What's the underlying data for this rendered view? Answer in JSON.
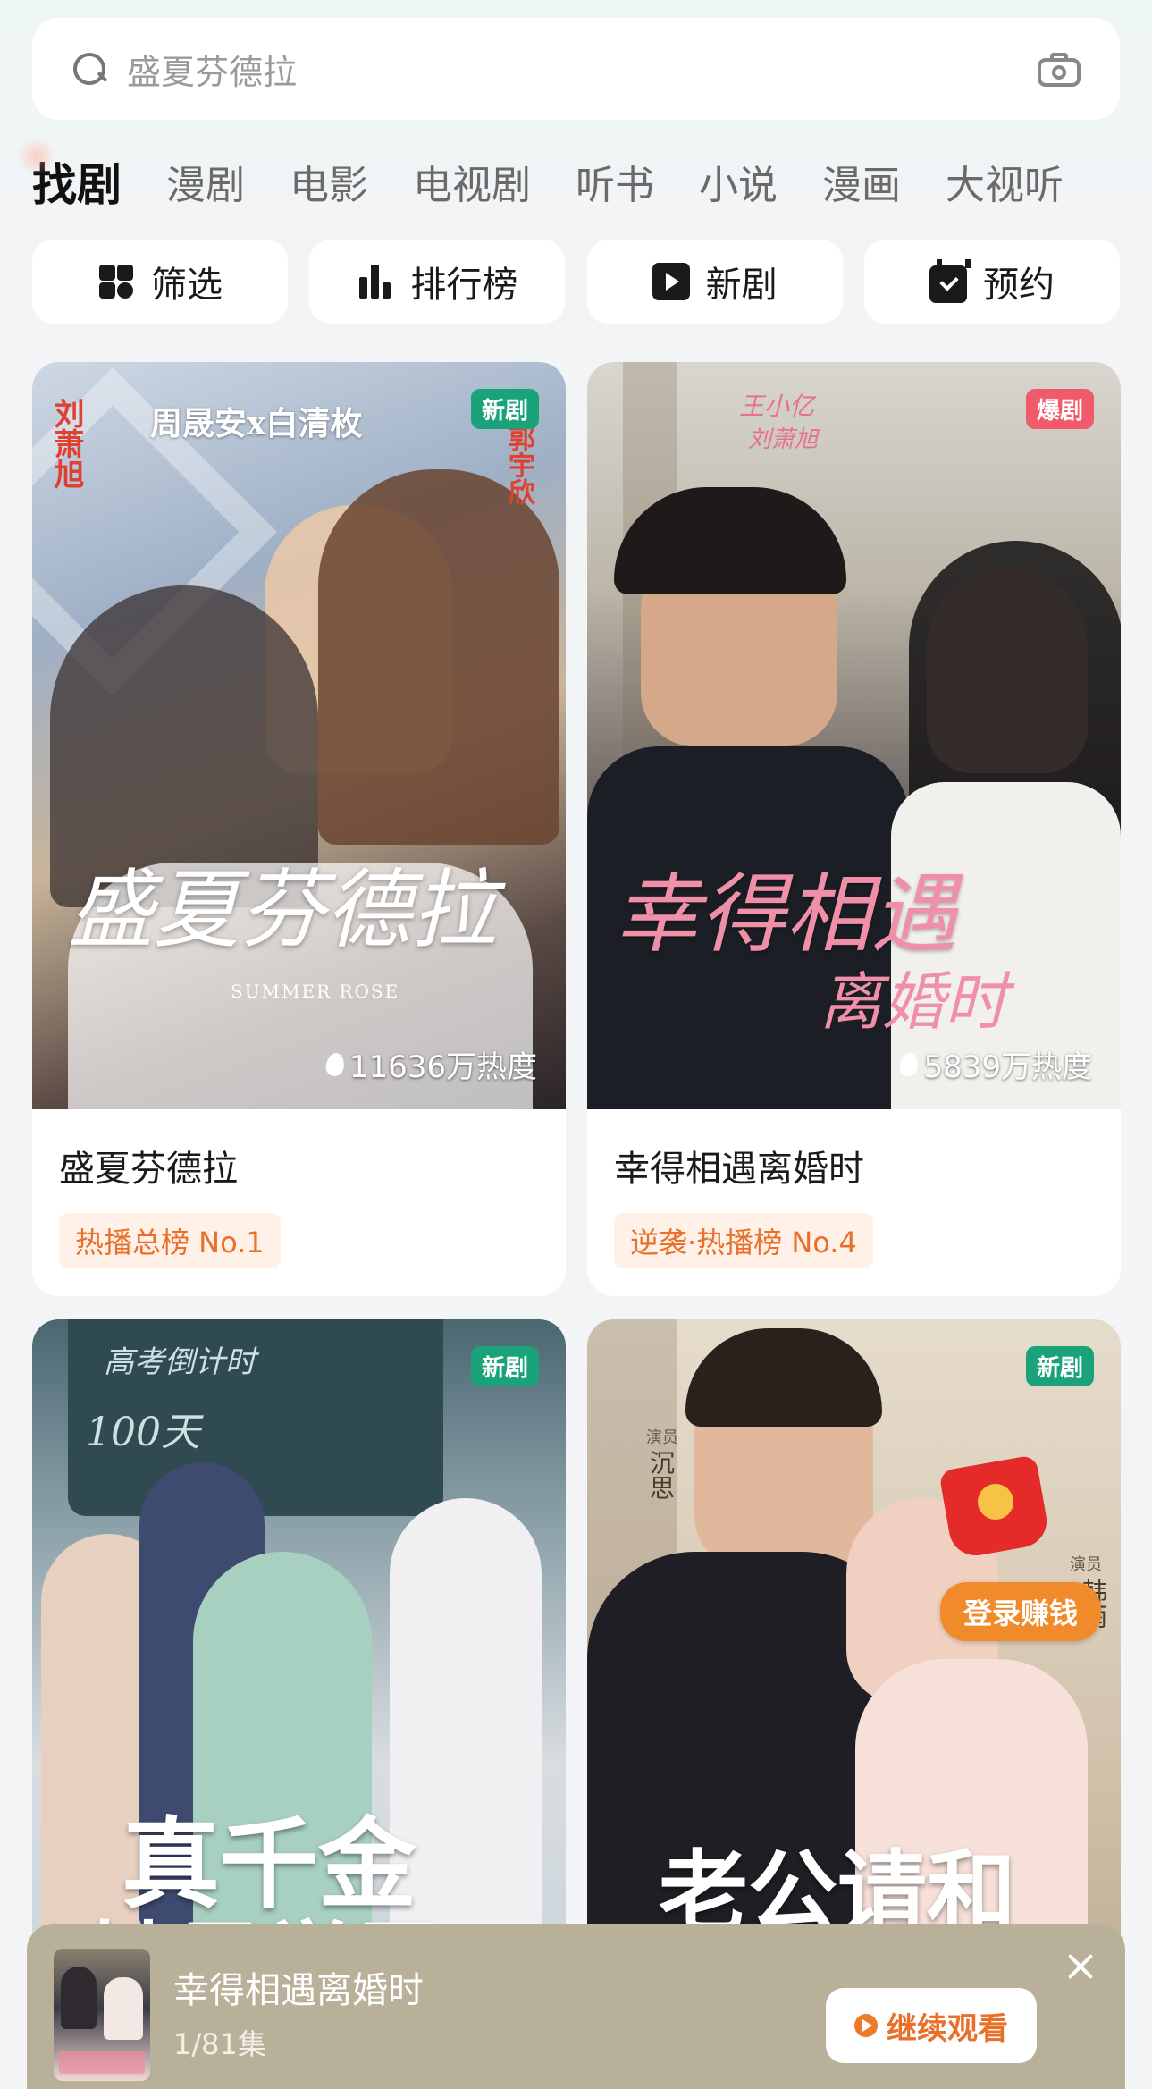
{
  "search": {
    "placeholder": "盛夏芬德拉"
  },
  "tabs": [
    {
      "label": "找剧",
      "active": true
    },
    {
      "label": "漫剧"
    },
    {
      "label": "电影"
    },
    {
      "label": "电视剧"
    },
    {
      "label": "听书"
    },
    {
      "label": "小说"
    },
    {
      "label": "漫画"
    },
    {
      "label": "大视听"
    }
  ],
  "quick": [
    {
      "label": "筛选",
      "icon": "grid-icon"
    },
    {
      "label": "排行榜",
      "icon": "chart-icon"
    },
    {
      "label": "新剧",
      "icon": "play-icon"
    },
    {
      "label": "预约",
      "icon": "calendar-icon"
    }
  ],
  "cards": [
    {
      "badge": "新剧",
      "heat": "11636万热度",
      "title": "盛夏芬德拉",
      "rank": "热播总榜 No.1",
      "poster_text": {
        "main": "盛夏芬德拉",
        "sub": "SUMMER ROSE",
        "cast_center": "周晟安x白清枚",
        "cast_left": "刘萧旭",
        "cast_right": "郭宇欣"
      }
    },
    {
      "badge": "爆剧",
      "heat": "5839万热度",
      "title": "幸得相遇离婚时",
      "rank": "逆袭·热播榜 No.4",
      "poster_text": {
        "main": "幸得相遇",
        "main2": "离婚时",
        "cast1": "王小亿",
        "cast2": "刘萧旭"
      }
    },
    {
      "badge": "新剧",
      "poster_text": {
        "main": "真千金",
        "main2": "她是学霸",
        "board": "高考倒计时",
        "days": "100天"
      }
    },
    {
      "badge": "新剧",
      "poster_text": {
        "main": "老公请和",
        "actor1_role": "演员",
        "actor1_name": "沉思",
        "actor2_role": "演员",
        "actor2_name": "韩雨"
      },
      "promo": "登录赚钱"
    }
  ],
  "player": {
    "title": "幸得相遇离婚时",
    "episode": "1/81集",
    "continue": "继续观看"
  },
  "colors": {
    "accent": "#e8702a",
    "badge_new": "#1aa37a",
    "badge_hot": "#f05a6a"
  }
}
